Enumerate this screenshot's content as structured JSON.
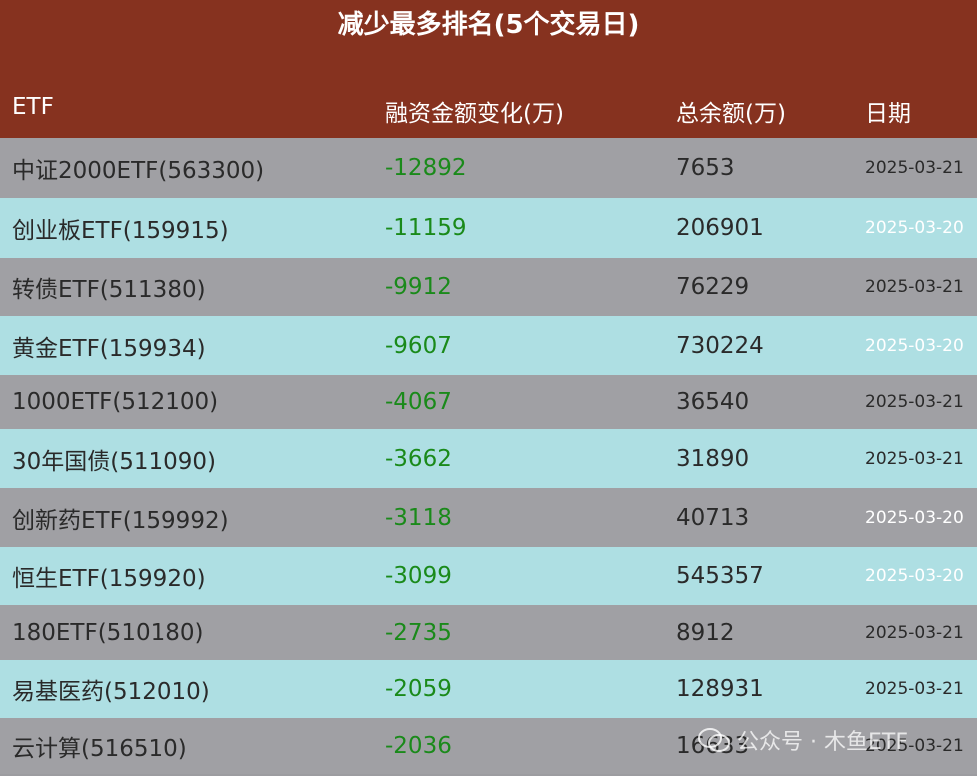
{
  "title": "减少最多排名(5个交易日)",
  "columns": [
    "ETF",
    "融资金额变化(万)",
    "总余额(万)",
    "日期"
  ],
  "rows": [
    {
      "name": "中证2000ETF(563300)",
      "change": "-12892",
      "total": "7653",
      "date": "2025-03-21"
    },
    {
      "name": "创业板ETF(159915)",
      "change": "-11159",
      "total": "206901",
      "date": "2025-03-20"
    },
    {
      "name": "转债ETF(511380)",
      "change": "-9912",
      "total": "76229",
      "date": "2025-03-21"
    },
    {
      "name": "黄金ETF(159934)",
      "change": "-9607",
      "total": "730224",
      "date": "2025-03-20"
    },
    {
      "name": "1000ETF(512100)",
      "change": "-4067",
      "total": "36540",
      "date": "2025-03-21"
    },
    {
      "name": "30年国债(511090)",
      "change": "-3662",
      "total": "31890",
      "date": "2025-03-21"
    },
    {
      "name": "创新药ETF(159992)",
      "change": "-3118",
      "total": "40713",
      "date": "2025-03-20"
    },
    {
      "name": "恒生ETF(159920)",
      "change": "-3099",
      "total": "545357",
      "date": "2025-03-20"
    },
    {
      "name": "180ETF(510180)",
      "change": "-2735",
      "total": "8912",
      "date": "2025-03-21"
    },
    {
      "name": "易基医药(512010)",
      "change": "-2059",
      "total": "128931",
      "date": "2025-03-21"
    },
    {
      "name": "云计算(516510)",
      "change": "-2036",
      "total": "16633",
      "date": "2025-03-21"
    }
  ],
  "colors": {
    "header_bg": "#86321f",
    "row_gray": "#a0a0a4",
    "row_cyan": "#aedfe3",
    "change_green": "#1a8a1a",
    "date_20": "#ffffff",
    "date_21": "#2a2a2a"
  },
  "watermark": {
    "text": "公众号 · 木鱼ETF",
    "icon": "wechat-icon"
  }
}
